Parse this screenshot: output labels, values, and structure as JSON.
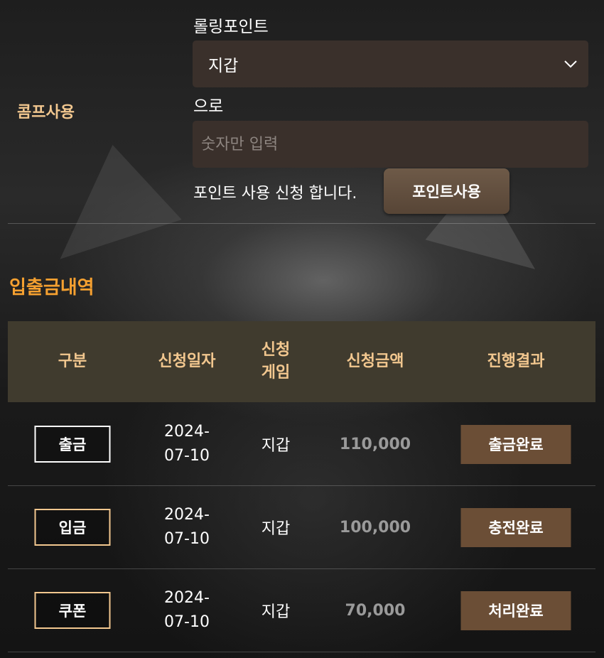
{
  "comp": {
    "label": "콤프사용",
    "rolling_label": "롤링포인트",
    "select_value": "지갑",
    "to_label": "으로",
    "amount_placeholder": "숫자만 입력",
    "apply_text": "포인트 사용 신청 합니다.",
    "use_button": "포인트사용"
  },
  "history": {
    "title": "입출금내역",
    "columns": {
      "type": "구분",
      "date": "신청일자",
      "game_line1": "신청",
      "game_line2": "게임",
      "amount": "신청금액",
      "result": "진행결과"
    },
    "rows": [
      {
        "type": "출금",
        "date_line1": "2024-",
        "date_line2": "07-10",
        "game": "지갑",
        "amount": "110,000",
        "status": "출금완료"
      },
      {
        "type": "입금",
        "date_line1": "2024-",
        "date_line2": "07-10",
        "game": "지갑",
        "amount": "100,000",
        "status": "충전완료"
      },
      {
        "type": "쿠폰",
        "date_line1": "2024-",
        "date_line2": "07-10",
        "game": "지갑",
        "amount": "70,000",
        "status": "처리완료"
      }
    ]
  },
  "colors": {
    "accent_orange": "#f5a030",
    "header_gold": "#f2c78f",
    "withdraw_border": "#ffffff",
    "deposit_border": "#f2c78f",
    "coupon_border": "#f2c78f",
    "status_button": "#6b4e36",
    "table_header_bg": "#403b2e",
    "field_bg": "#3a302b"
  },
  "icons": {
    "select_arrow": "chevron-down-icon"
  }
}
